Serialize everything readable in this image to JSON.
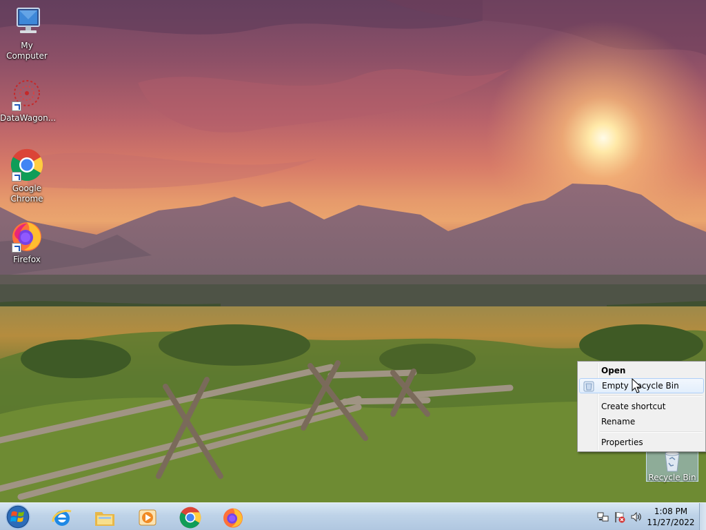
{
  "desktop": {
    "icons": [
      {
        "label": "My Computer",
        "icon": "computer-icon"
      },
      {
        "label": "DataWagon...",
        "icon": "datawagon-icon"
      },
      {
        "label": "Google Chrome",
        "icon": "chrome-icon"
      },
      {
        "label": "Firefox",
        "icon": "firefox-icon"
      }
    ],
    "recycle_bin": {
      "label": "Recycle Bin",
      "icon": "recycle-bin-icon"
    }
  },
  "context_menu": {
    "items": [
      {
        "label": "Open",
        "bold": true
      },
      {
        "label": "Empty Recycle Bin",
        "highlighted": true,
        "icon": "shield-icon"
      },
      {
        "label": "Create shortcut"
      },
      {
        "label": "Rename"
      },
      {
        "label": "Properties"
      }
    ]
  },
  "taskbar": {
    "start_icon": "windows-orb-icon",
    "pinned": [
      {
        "name": "Internet Explorer",
        "icon": "ie-icon"
      },
      {
        "name": "Windows Explorer",
        "icon": "folder-icon"
      },
      {
        "name": "Windows Media Player",
        "icon": "media-player-icon"
      },
      {
        "name": "Google Chrome",
        "icon": "chrome-icon"
      },
      {
        "name": "Firefox",
        "icon": "firefox-icon"
      }
    ],
    "tray_icons": [
      "network-icon",
      "action-center-flag-icon",
      "volume-icon"
    ],
    "clock": {
      "time": "1:08 PM",
      "date": "11/27/2022"
    }
  },
  "colors": {
    "taskbar": "#c4d7ea",
    "menu_bg": "#f0f0f0",
    "menu_highlight_border": "#aecff7"
  }
}
